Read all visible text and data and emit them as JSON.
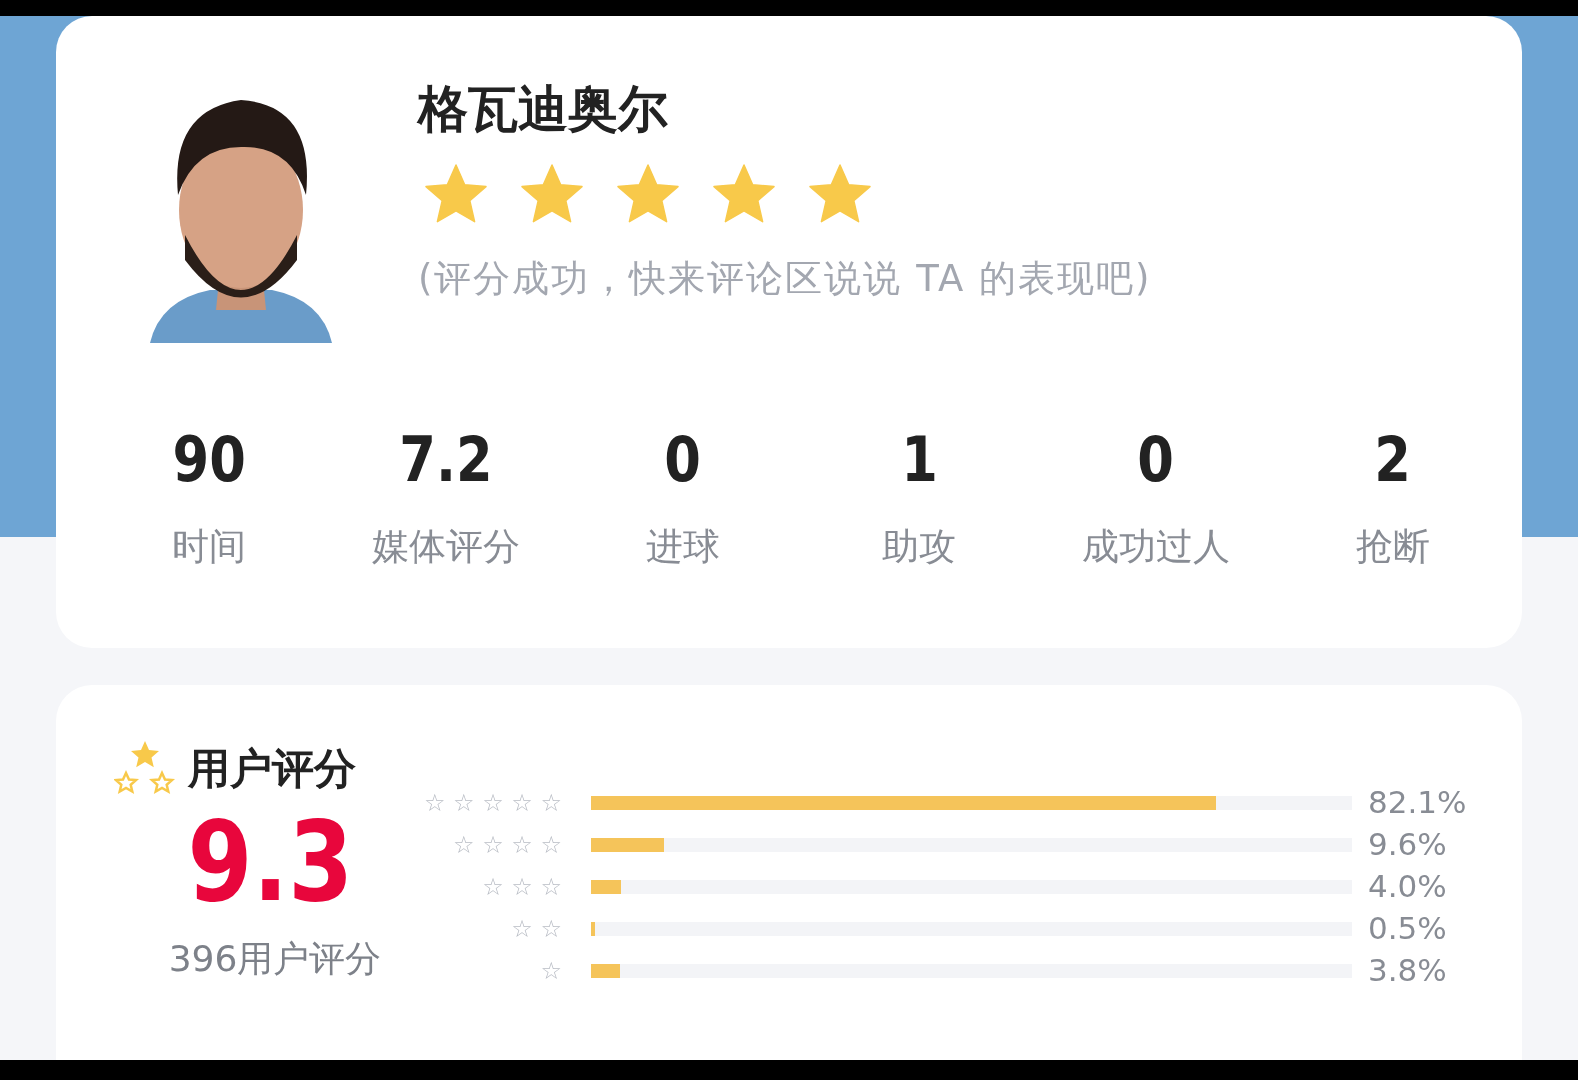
{
  "player": {
    "name": "格瓦迪奥尔",
    "stars": 5,
    "message": "(评分成功，快来评论区说说 TA 的表现吧)"
  },
  "stats": [
    {
      "value": "90",
      "label": "时间"
    },
    {
      "value": "7.2",
      "label": "媒体评分"
    },
    {
      "value": "0",
      "label": "进球"
    },
    {
      "value": "1",
      "label": "助攻"
    },
    {
      "value": "0",
      "label": "成功过人"
    },
    {
      "value": "2",
      "label": "抢断"
    }
  ],
  "user_rating": {
    "title": "用户评分",
    "score": "9.3",
    "count": "396用户评分",
    "distribution": [
      {
        "star_label": "☆ ☆ ☆ ☆ ☆",
        "level": 0.821,
        "percent": "82.1%"
      },
      {
        "star_label": "☆ ☆ ☆ ☆",
        "level": 0.096,
        "percent": "9.6%"
      },
      {
        "star_label": "☆ ☆ ☆",
        "level": 0.04,
        "percent": "4.0%"
      },
      {
        "star_label": "☆ ☆",
        "level": 0.005,
        "percent": "0.5%"
      },
      {
        "star_label": "☆",
        "level": 0.038,
        "percent": "3.8%"
      }
    ]
  }
}
